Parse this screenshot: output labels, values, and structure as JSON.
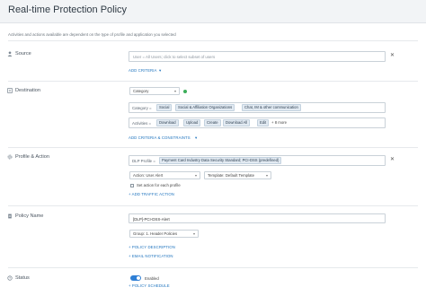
{
  "page": {
    "title": "Real-time Protection Policy",
    "subtitle": "Activities and actions available are dependent on the type of profile and application you selected"
  },
  "source": {
    "label": "Source",
    "placeholder": "User = All Users; click to select subset of users",
    "add_criteria": "ADD CRITERIA"
  },
  "destination": {
    "label": "Destination",
    "type_select": "Category",
    "category_label": "Category =",
    "categories": [
      "Social",
      "Social & Affiliation Organizations",
      "Chat, IM & other communication"
    ],
    "activities_label": "Activities =",
    "activities": [
      "Download",
      "Upload",
      "Create",
      "Download All",
      "Edit"
    ],
    "activities_more": "+ 8 more",
    "add_criteria": "ADD CRITERIA & CONSTRAINTS"
  },
  "profile_action": {
    "label": "Profile & Action",
    "dlp_label": "DLP Profile =",
    "dlp_value": "Payment Card Industry Data Security Standard; PCI-DSS (predefined)",
    "action": "Action: User Alert",
    "template": "Template: Default Template",
    "set_each": "Set action for each profile",
    "add_traffic": "+ ADD TRAFFIC ACTION"
  },
  "policy_name": {
    "label": "Policy Name",
    "value": "[DLP]-PCI-DSS-Alert",
    "group": "Group: 1. Header Policies",
    "add_description": "+ POLICY DESCRIPTION",
    "add_email": "+ EMAIL NOTIFICATION"
  },
  "status": {
    "label": "Status",
    "toggle_label": "Enabled",
    "add_schedule": "+ POLICY SCHEDULE"
  }
}
